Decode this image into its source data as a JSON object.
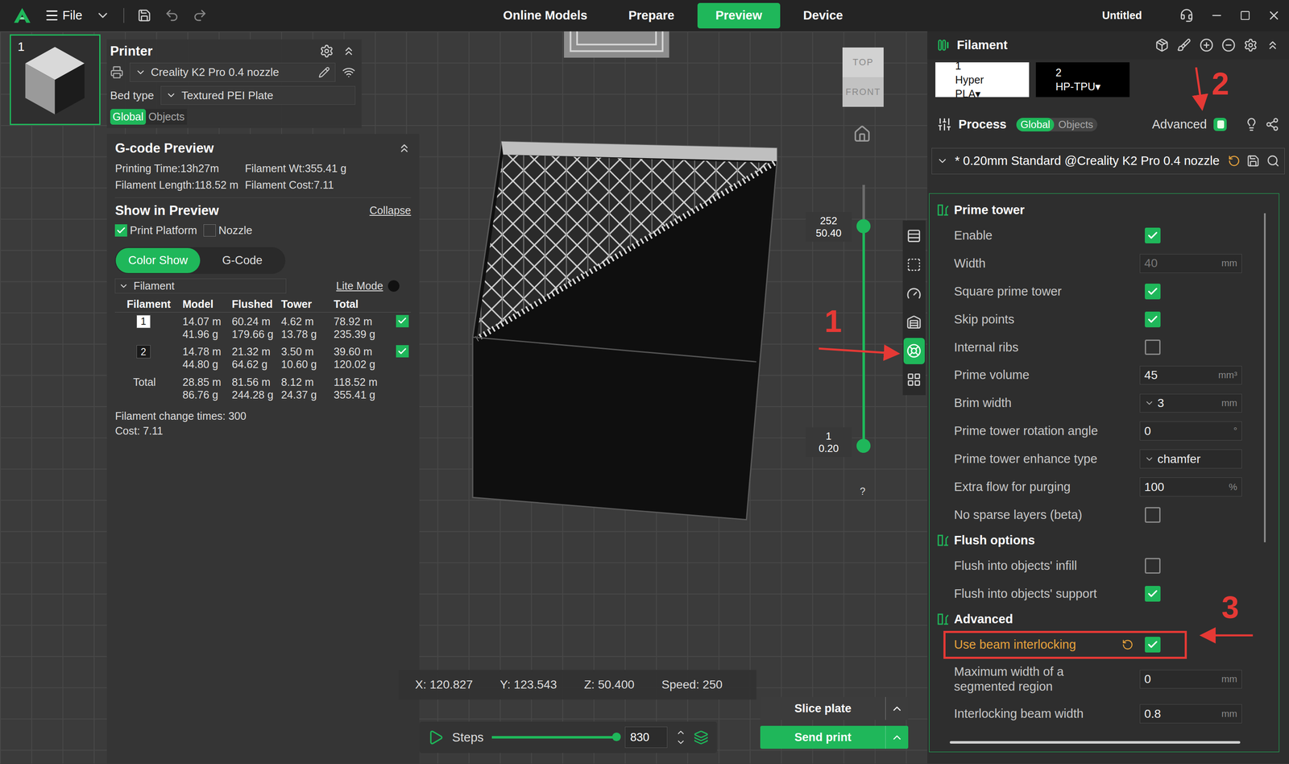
{
  "topbar": {
    "menu": "File",
    "tabs": [
      {
        "label": "Online Models",
        "selected": false
      },
      {
        "label": "Prepare",
        "selected": false
      },
      {
        "label": "Preview",
        "selected": true
      },
      {
        "label": "Device",
        "selected": false
      }
    ],
    "title": "Untitled"
  },
  "plate": {
    "number": "1",
    "selected": true
  },
  "printer": {
    "title": "Printer",
    "name": "Creality K2 Pro 0.4 nozzle",
    "bed_label": "Bed type",
    "bed": "Textured PEI Plate",
    "scope": [
      {
        "label": "Global",
        "selected": true
      },
      {
        "label": "Objects",
        "selected": false
      }
    ]
  },
  "gcode_preview": {
    "title": "G-code Preview",
    "stats": [
      "Printing Time:13h27m",
      "Filament Wt:355.41 g",
      "Filament Length:118.52 m",
      "Filament Cost:7.11"
    ],
    "show_title": "Show in Preview",
    "collapse": "Collapse",
    "options": [
      {
        "label": "Print Platform",
        "checked": true
      },
      {
        "label": "Nozzle",
        "checked": false
      }
    ],
    "view_tabs": [
      {
        "label": "Color Show",
        "selected": true
      },
      {
        "label": "G-Code",
        "selected": false
      }
    ],
    "group_by": "Filament",
    "lite_mode": {
      "label": "Lite Mode",
      "on": false
    },
    "columns": [
      "Filament",
      "Model",
      "Flushed",
      "Tower",
      "Total"
    ],
    "rows": [
      {
        "filament": "1",
        "color": "#ffffff",
        "model": [
          "14.07 m",
          "41.96 g"
        ],
        "flushed": [
          "60.24 m",
          "179.66 g"
        ],
        "tower": [
          "4.62 m",
          "13.78 g"
        ],
        "total": [
          "78.92 m",
          "235.39 g"
        ],
        "visible": true
      },
      {
        "filament": "2",
        "color": "#1a1a1a",
        "model": [
          "14.78 m",
          "44.80 g"
        ],
        "flushed": [
          "21.32 m",
          "64.62 g"
        ],
        "tower": [
          "3.50 m",
          "10.60 g"
        ],
        "total": [
          "39.60 m",
          "120.02 g"
        ],
        "visible": true
      }
    ],
    "total": {
      "label": "Total",
      "model": [
        "28.85 m",
        "86.76 g"
      ],
      "flushed": [
        "81.56 m",
        "244.28 g"
      ],
      "tower": [
        "8.12 m",
        "24.37 g"
      ],
      "total": [
        "118.52 m",
        "355.41 g"
      ]
    },
    "change_times": "Filament change times: 300",
    "cost": "Cost: 7.11"
  },
  "view_cube": {
    "top": "TOP",
    "front": "FRONT"
  },
  "layer_slider": {
    "upper": {
      "layer": "252",
      "height": "50.40"
    },
    "lower": {
      "layer": "1",
      "height": "0.20"
    },
    "level": 0.84,
    "help": "?"
  },
  "side_tools": [
    {
      "selected": false
    },
    {
      "selected": false
    },
    {
      "selected": false
    },
    {
      "selected": false
    },
    {
      "selected": true
    },
    {
      "selected": false
    }
  ],
  "coords": [
    "X: 120.827",
    "Y: 123.543",
    "Z: 50.400",
    "Speed: 250"
  ],
  "steps": {
    "label": "Steps",
    "value": "830",
    "level": 1
  },
  "actions": {
    "slice": "Slice plate",
    "send": "Send print"
  },
  "filament_panel": {
    "title": "Filament",
    "filaments": [
      {
        "index": "1",
        "name": "Hyper PLA▾",
        "color": "#ffffff"
      },
      {
        "index": "2",
        "name": "HP-TPU▾",
        "color": "#000000"
      }
    ]
  },
  "process": {
    "title": "Process",
    "scope": [
      {
        "label": "Global",
        "selected": true
      },
      {
        "label": "Objects",
        "selected": false
      }
    ],
    "advanced_label": "Advanced",
    "advanced": true,
    "preset": "* 0.20mm Standard @Creality K2 Pro 0.4 nozzle"
  },
  "settings": {
    "sections": [
      {
        "title": "Prime tower",
        "rows": [
          {
            "kind": "check",
            "label": "Enable",
            "checked": true
          },
          {
            "kind": "input",
            "label": "Width",
            "value": "40",
            "unit": "mm",
            "disabled": true
          },
          {
            "kind": "check",
            "label": "Square prime tower",
            "checked": true
          },
          {
            "kind": "check",
            "label": "Skip points",
            "checked": true
          },
          {
            "kind": "check",
            "label": "Internal ribs",
            "checked": false
          },
          {
            "kind": "input",
            "label": "Prime volume",
            "value": "45",
            "unit": "mm³",
            "disabled": false
          },
          {
            "kind": "select",
            "label": "Brim width",
            "value": "3",
            "unit": "mm"
          },
          {
            "kind": "input",
            "label": "Prime tower rotation angle",
            "value": "0",
            "unit": "°",
            "disabled": false
          },
          {
            "kind": "select",
            "label": "Prime tower enhance type",
            "value": "chamfer",
            "unit": ""
          },
          {
            "kind": "input",
            "label": "Extra flow for purging",
            "value": "100",
            "unit": "%",
            "disabled": false
          },
          {
            "kind": "check",
            "label": "No sparse layers (beta)",
            "checked": false
          }
        ]
      },
      {
        "title": "Flush options",
        "rows": [
          {
            "kind": "check",
            "label": "Flush into objects' infill",
            "checked": false
          },
          {
            "kind": "check",
            "label": "Flush into objects' support",
            "checked": true
          }
        ]
      },
      {
        "title": "Advanced",
        "rows": [
          {
            "kind": "check",
            "label": "Use beam interlocking",
            "checked": true,
            "modified": true,
            "highlighted": true
          },
          {
            "kind": "input",
            "label": "Maximum width of a segmented region",
            "value": "0",
            "unit": "mm",
            "disabled": false
          },
          {
            "kind": "input",
            "label": "Interlocking beam width",
            "value": "0.8",
            "unit": "mm",
            "disabled": false
          }
        ]
      }
    ]
  },
  "annotations": [
    {
      "label": "1"
    },
    {
      "label": "2"
    },
    {
      "label": "3"
    }
  ]
}
